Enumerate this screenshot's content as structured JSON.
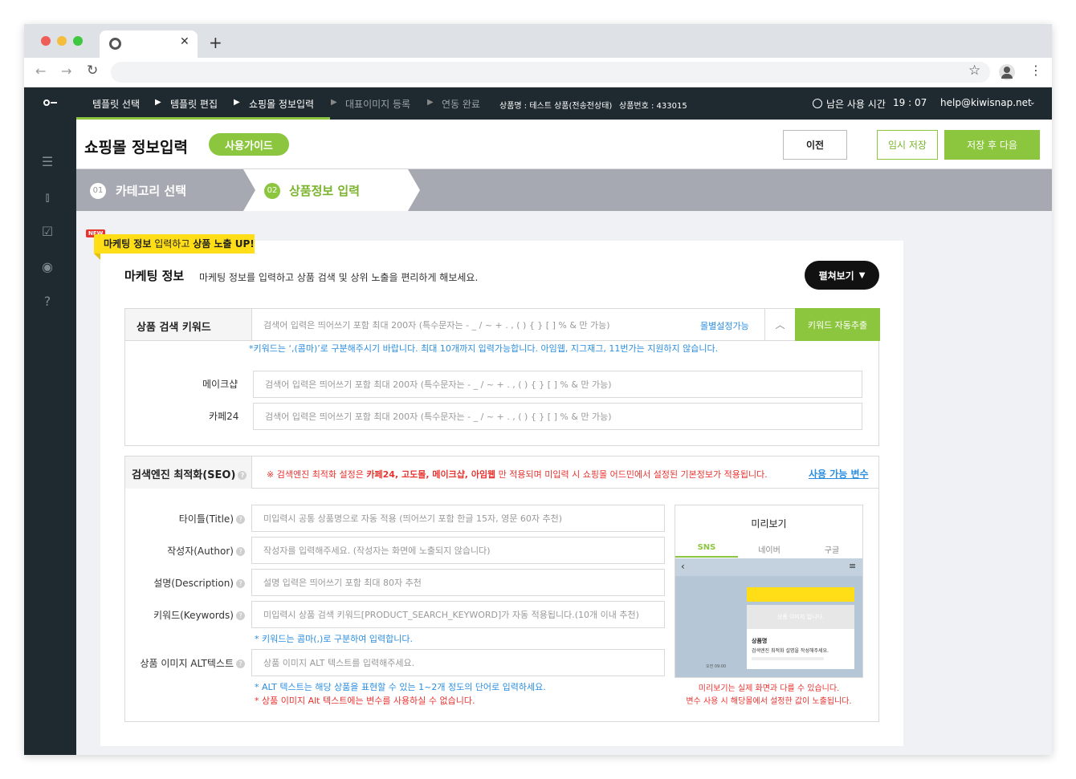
{
  "browser": {
    "new_tab": "+"
  },
  "nav": {
    "steps": [
      "템플릿 선택",
      "템플릿 편집",
      "쇼핑몰 정보입력",
      "대표이미지 등록",
      "연동 완료"
    ],
    "product_name": "상품명 : 테스트 상품(전송전상태)",
    "product_no": "상품번호 : 433015",
    "time_label": "남은 사용 시간",
    "time_value": "19 : 07",
    "email": "help@kiwisnap.net"
  },
  "header": {
    "title": "쇼핑몰 정보입력",
    "guide": "사용가이드",
    "prev": "이전",
    "temp_save": "임시 저장",
    "save_next": "저장 후 다음"
  },
  "progress": {
    "step1_num": "01",
    "step1": "카테고리 선택",
    "step2_num": "02",
    "step2": "상품정보 입력"
  },
  "marketing": {
    "badge_new": "NEW",
    "banner_a": "마케팅 정보",
    "banner_b": " 입력하고 ",
    "banner_c": "상품 노출 UP!",
    "title": "마케팅 정보",
    "desc": "마케팅 정보를 입력하고 상품 검색 및 상위 노출을 편리하게 해보세요.",
    "expand": "펼쳐보기"
  },
  "keywords": {
    "label": "상품 검색 키워드",
    "placeholder": "검색어 입력은 띄어쓰기 포함 최대 200자 (특수문자는 - _ / ~ + . , ( ) { } [ ] % & 만 가능)",
    "per_mall": "몰별설정가능",
    "auto": "키워드 자동추출",
    "note": "*키워드는 ‘,(콤마)’로 구분해주시기 바랍니다. 최대 10개까지 입력가능합니다. 아임웹, 지그재그, 11번가는 지원하지 않습니다.",
    "makeshop_label": "메이크샵",
    "cafe24_label": "카페24"
  },
  "seo": {
    "title": "검색엔진 최적화(SEO)",
    "note_a": "※ 검색엔진 최적화 설정은 ",
    "note_b": "카페24, 고도몰, 메이크샵, 아임웹",
    "note_c": " 만 적용되며 미입력 시 쇼핑몰 어드민에서 설정된 기본정보가 적용됩니다.",
    "vars_link": "사용 가능 변수",
    "fields": [
      {
        "label": "타이틀(Title)",
        "placeholder": "미입력시 공통 상품명으로 자동 적용 (띄어쓰기 포함 한글 15자, 영문 60자 추천)"
      },
      {
        "label": "작성자(Author)",
        "placeholder": "작성자를 입력해주세요. (작성자는 화면에 노출되지 않습니다)"
      },
      {
        "label": "설명(Description)",
        "placeholder": "설명 입력은 띄어쓰기 포함 최대 80자 추천"
      },
      {
        "label": "키워드(Keywords)",
        "placeholder": "미입력시 상품 검색 키워드[PRODUCT_SEARCH_KEYWORD]가 자동 적용됩니다.(10개 이내 추천)"
      },
      {
        "label": "상품 이미지 ALT텍스트",
        "placeholder": "상품 이미지 ALT 텍스트를 입력해주세요."
      }
    ],
    "kw_note": "* 키워드는 콤마(,)로 구분하여 입력합니다.",
    "alt_note1": "* ALT 텍스트는 해당 상품을 표현할 수 있는 1~2개 정도의 단어로 입력하세요.",
    "alt_note2": "* 상품 이미지 Alt 텍스트에는 변수를 사용하실 수 없습니다."
  },
  "preview": {
    "title": "미리보기",
    "tabs": [
      "SNS",
      "네이버",
      "구글"
    ],
    "img_text": "상품 이미지 입니다.",
    "prod_name": "상품명",
    "prod_desc": "검색엔진 최적화 설명을 작성해주세요.",
    "time": "오전 09:00",
    "note1": "미리보기는 실제 화면과 다를 수 있습니다.",
    "note2": "변수 사용 시 해당몰에서 설정한 값이 노출됩니다."
  },
  "colors": {
    "brand_green": "#8cc63e",
    "dark": "#1f2a30",
    "link_blue": "#2b8ee0",
    "red": "#e8332f"
  }
}
